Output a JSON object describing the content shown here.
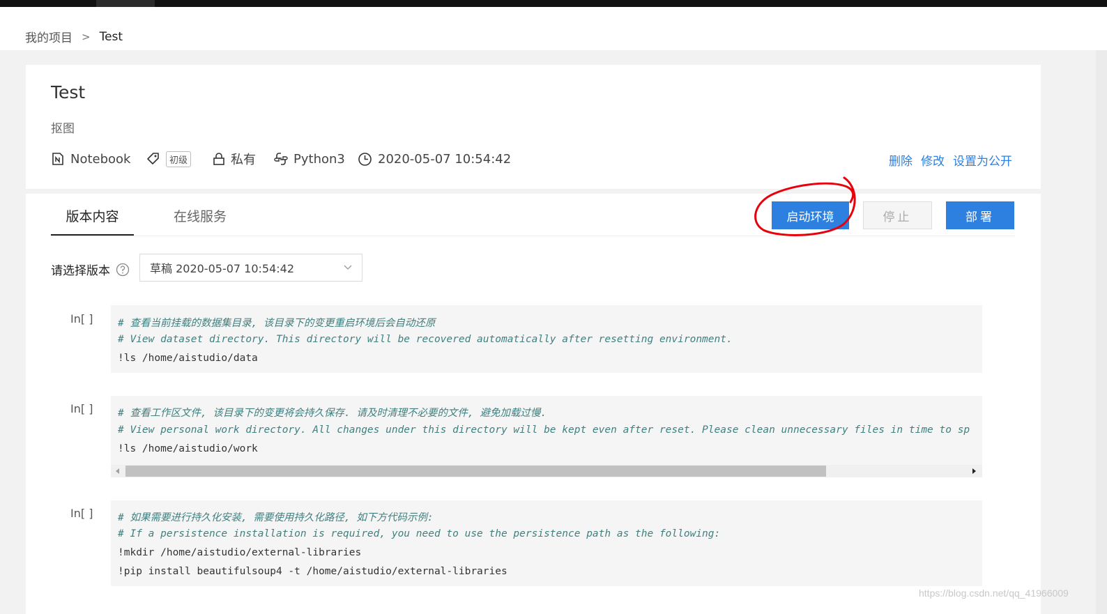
{
  "breadcrumb": {
    "root": "我的项目",
    "separator": ">",
    "current": "Test"
  },
  "project": {
    "title": "Test",
    "description": "抠图",
    "meta": {
      "type": "Notebook",
      "level_badge": "初级",
      "visibility": "私有",
      "env": "Python3",
      "datetime": "2020-05-07 10:54:42"
    },
    "actions": {
      "delete": "删除",
      "edit": "修改",
      "make_public": "设置为公开"
    }
  },
  "tabs": {
    "version_content": "版本内容",
    "online_service": "在线服务"
  },
  "buttons": {
    "start_env": "启动环境",
    "stop": "停止",
    "deploy": "部署"
  },
  "version": {
    "label": "请选择版本",
    "selected": "草稿 2020-05-07 10:54:42"
  },
  "cells": [
    {
      "prompt": "In[ ]",
      "lines": [
        "# 查看当前挂载的数据集目录, 该目录下的变更重启环境后会自动还原",
        "# View dataset directory. This directory will be recovered automatically after resetting environment.",
        "!ls /home/aistudio/data"
      ]
    },
    {
      "prompt": "In[ ]",
      "lines": [
        "# 查看工作区文件, 该目录下的变更将会持久保存. 请及时清理不必要的文件, 避免加载过慢.",
        "# View personal work directory. All changes under this directory will be kept even after reset. Please clean unnecessary files in time to sp",
        "!ls /home/aistudio/work"
      ]
    },
    {
      "prompt": "In[ ]",
      "lines": [
        "# 如果需要进行持久化安装, 需要使用持久化路径, 如下方代码示例:",
        "# If a persistence installation is required, you need to use the persistence path as the following:",
        "!mkdir /home/aistudio/external-libraries",
        "!pip install beautifulsoup4 -t /home/aistudio/external-libraries"
      ]
    }
  ],
  "watermark": "https://blog.csdn.net/qq_41966009",
  "colors": {
    "primary": "#2d7fe0",
    "link": "#2d7fe0",
    "annotation": "#e8000b",
    "comment": "#408080"
  }
}
